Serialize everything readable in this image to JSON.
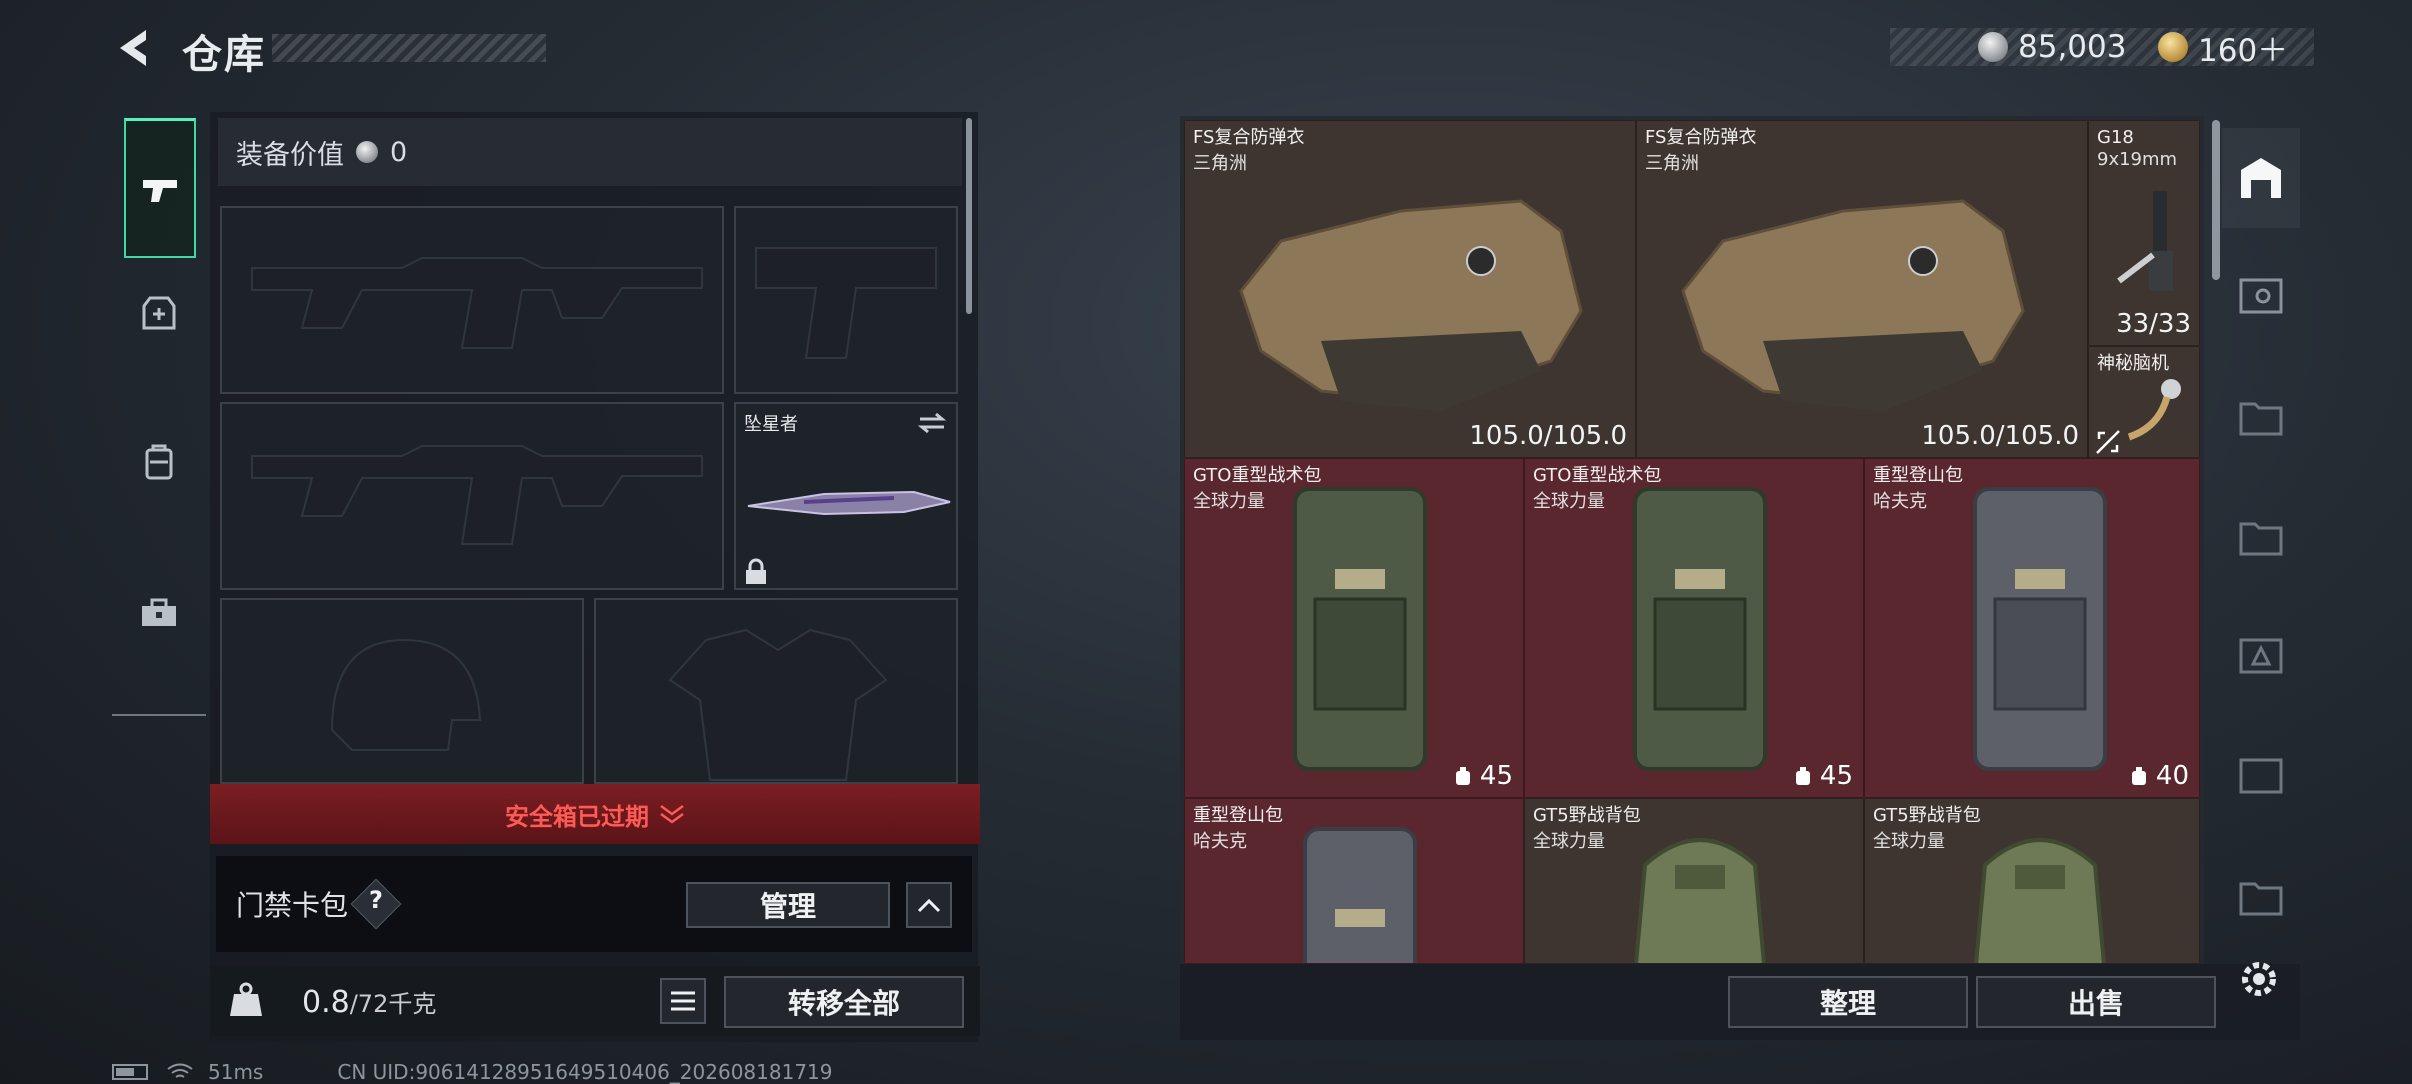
{
  "header": {
    "title": "仓库",
    "currency_silver": "85,003",
    "currency_gold": "160＋"
  },
  "left_rail": {
    "items": [
      "pistol-icon",
      "armor-icon",
      "backpack-icon",
      "toolbox-icon"
    ]
  },
  "equipment": {
    "value_label": "装备价值",
    "value": "0",
    "melee_name": "坠星者",
    "safe_box_status": "安全箱已过期",
    "card_pack_label": "门禁卡包",
    "help_text": "?",
    "manage_button": "管理",
    "weight_current": "0.8",
    "weight_capacity": "/72千克",
    "transfer_all_button": "转移全部"
  },
  "storage": {
    "items": [
      {
        "name": "FS复合防弹衣",
        "sub": "三角洲",
        "value": "105.0/105.0"
      },
      {
        "name": "FS复合防弹衣",
        "sub": "三角洲",
        "value": "105.0/105.0"
      },
      {
        "name": "G18",
        "sub": "9x19mm",
        "value": "33/33"
      },
      {
        "name": "神秘脑机",
        "sub": "",
        "value": ""
      },
      {
        "name": "GTO重型战术包",
        "sub": "全球力量",
        "value": "45"
      },
      {
        "name": "GTO重型战术包",
        "sub": "全球力量",
        "value": "45"
      },
      {
        "name": "重型登山包",
        "sub": "哈夫克",
        "value": "40"
      },
      {
        "name": "重型登山包",
        "sub": "哈夫克",
        "value": ""
      },
      {
        "name": "GT5野战背包",
        "sub": "全球力量",
        "value": ""
      },
      {
        "name": "GT5野战背包",
        "sub": "全球力量",
        "value": ""
      }
    ],
    "sort_button": "整理",
    "sell_button": "出售"
  },
  "status": {
    "ping": "51ms",
    "uid": "CN UID:9061412895164951040​6_202608181719"
  },
  "colors": {
    "accent_green": "#3fd9a4",
    "warning_red": "#ff5a54",
    "cell_brown": "#3f3530",
    "cell_red": "#5b272e"
  }
}
